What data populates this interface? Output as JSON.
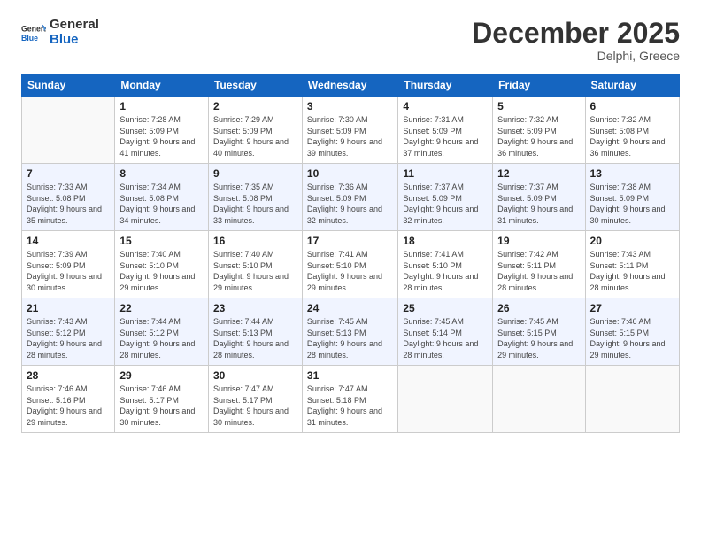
{
  "header": {
    "logo_general": "General",
    "logo_blue": "Blue",
    "month_title": "December 2025",
    "subtitle": "Delphi, Greece"
  },
  "weekdays": [
    "Sunday",
    "Monday",
    "Tuesday",
    "Wednesday",
    "Thursday",
    "Friday",
    "Saturday"
  ],
  "weeks": [
    [
      {
        "day": "",
        "empty": true
      },
      {
        "day": "1",
        "sunrise": "7:28 AM",
        "sunset": "5:09 PM",
        "daylight": "9 hours and 41 minutes."
      },
      {
        "day": "2",
        "sunrise": "7:29 AM",
        "sunset": "5:09 PM",
        "daylight": "9 hours and 40 minutes."
      },
      {
        "day": "3",
        "sunrise": "7:30 AM",
        "sunset": "5:09 PM",
        "daylight": "9 hours and 39 minutes."
      },
      {
        "day": "4",
        "sunrise": "7:31 AM",
        "sunset": "5:09 PM",
        "daylight": "9 hours and 37 minutes."
      },
      {
        "day": "5",
        "sunrise": "7:32 AM",
        "sunset": "5:09 PM",
        "daylight": "9 hours and 36 minutes."
      },
      {
        "day": "6",
        "sunrise": "7:32 AM",
        "sunset": "5:08 PM",
        "daylight": "9 hours and 36 minutes."
      }
    ],
    [
      {
        "day": "7",
        "sunrise": "7:33 AM",
        "sunset": "5:08 PM",
        "daylight": "9 hours and 35 minutes."
      },
      {
        "day": "8",
        "sunrise": "7:34 AM",
        "sunset": "5:08 PM",
        "daylight": "9 hours and 34 minutes."
      },
      {
        "day": "9",
        "sunrise": "7:35 AM",
        "sunset": "5:08 PM",
        "daylight": "9 hours and 33 minutes."
      },
      {
        "day": "10",
        "sunrise": "7:36 AM",
        "sunset": "5:09 PM",
        "daylight": "9 hours and 32 minutes."
      },
      {
        "day": "11",
        "sunrise": "7:37 AM",
        "sunset": "5:09 PM",
        "daylight": "9 hours and 32 minutes."
      },
      {
        "day": "12",
        "sunrise": "7:37 AM",
        "sunset": "5:09 PM",
        "daylight": "9 hours and 31 minutes."
      },
      {
        "day": "13",
        "sunrise": "7:38 AM",
        "sunset": "5:09 PM",
        "daylight": "9 hours and 30 minutes."
      }
    ],
    [
      {
        "day": "14",
        "sunrise": "7:39 AM",
        "sunset": "5:09 PM",
        "daylight": "9 hours and 30 minutes."
      },
      {
        "day": "15",
        "sunrise": "7:40 AM",
        "sunset": "5:10 PM",
        "daylight": "9 hours and 29 minutes."
      },
      {
        "day": "16",
        "sunrise": "7:40 AM",
        "sunset": "5:10 PM",
        "daylight": "9 hours and 29 minutes."
      },
      {
        "day": "17",
        "sunrise": "7:41 AM",
        "sunset": "5:10 PM",
        "daylight": "9 hours and 29 minutes."
      },
      {
        "day": "18",
        "sunrise": "7:41 AM",
        "sunset": "5:10 PM",
        "daylight": "9 hours and 28 minutes."
      },
      {
        "day": "19",
        "sunrise": "7:42 AM",
        "sunset": "5:11 PM",
        "daylight": "9 hours and 28 minutes."
      },
      {
        "day": "20",
        "sunrise": "7:43 AM",
        "sunset": "5:11 PM",
        "daylight": "9 hours and 28 minutes."
      }
    ],
    [
      {
        "day": "21",
        "sunrise": "7:43 AM",
        "sunset": "5:12 PM",
        "daylight": "9 hours and 28 minutes."
      },
      {
        "day": "22",
        "sunrise": "7:44 AM",
        "sunset": "5:12 PM",
        "daylight": "9 hours and 28 minutes."
      },
      {
        "day": "23",
        "sunrise": "7:44 AM",
        "sunset": "5:13 PM",
        "daylight": "9 hours and 28 minutes."
      },
      {
        "day": "24",
        "sunrise": "7:45 AM",
        "sunset": "5:13 PM",
        "daylight": "9 hours and 28 minutes."
      },
      {
        "day": "25",
        "sunrise": "7:45 AM",
        "sunset": "5:14 PM",
        "daylight": "9 hours and 28 minutes."
      },
      {
        "day": "26",
        "sunrise": "7:45 AM",
        "sunset": "5:15 PM",
        "daylight": "9 hours and 29 minutes."
      },
      {
        "day": "27",
        "sunrise": "7:46 AM",
        "sunset": "5:15 PM",
        "daylight": "9 hours and 29 minutes."
      }
    ],
    [
      {
        "day": "28",
        "sunrise": "7:46 AM",
        "sunset": "5:16 PM",
        "daylight": "9 hours and 29 minutes."
      },
      {
        "day": "29",
        "sunrise": "7:46 AM",
        "sunset": "5:17 PM",
        "daylight": "9 hours and 30 minutes."
      },
      {
        "day": "30",
        "sunrise": "7:47 AM",
        "sunset": "5:17 PM",
        "daylight": "9 hours and 30 minutes."
      },
      {
        "day": "31",
        "sunrise": "7:47 AM",
        "sunset": "5:18 PM",
        "daylight": "9 hours and 31 minutes."
      },
      {
        "day": "",
        "empty": true
      },
      {
        "day": "",
        "empty": true
      },
      {
        "day": "",
        "empty": true
      }
    ]
  ]
}
